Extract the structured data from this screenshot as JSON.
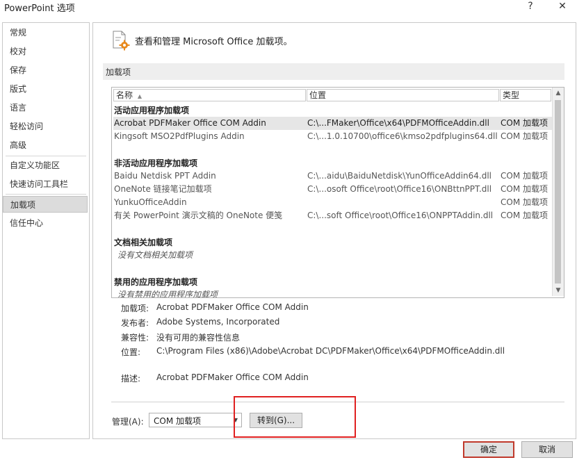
{
  "window": {
    "title": "PowerPoint 选项",
    "help_glyph": "?",
    "close_glyph": "✕"
  },
  "sidebar": {
    "items": [
      {
        "label": "常规"
      },
      {
        "label": "校对"
      },
      {
        "label": "保存"
      },
      {
        "label": "版式"
      },
      {
        "label": "语言"
      },
      {
        "label": "轻松访问"
      },
      {
        "label": "高级"
      },
      {
        "label": "自定义功能区"
      },
      {
        "label": "快速访问工具栏"
      },
      {
        "label": "加载项",
        "selected": true
      },
      {
        "label": "信任中心"
      }
    ]
  },
  "main": {
    "heading": "查看和管理 Microsoft Office 加载项。",
    "section_title": "加载项",
    "columns": {
      "name": "名称",
      "location": "位置",
      "type": "类型"
    },
    "groups": {
      "active": {
        "title": "活动应用程序加载项",
        "rows": [
          {
            "name": "Acrobat PDFMaker Office COM Addin",
            "location": "C:\\...FMaker\\Office\\x64\\PDFMOfficeAddin.dll",
            "type": "COM 加载项"
          },
          {
            "name": "Kingsoft MSO2PdfPlugins Addin",
            "location": "C:\\...1.0.10700\\office6\\kmso2pdfplugins64.dll",
            "type": "COM 加载项"
          }
        ]
      },
      "inactive": {
        "title": "非活动应用程序加载项",
        "rows": [
          {
            "name": "Baidu Netdisk PPT Addin",
            "location": "C:\\...aidu\\BaiduNetdisk\\YunOfficeAddin64.dll",
            "type": "COM 加载项"
          },
          {
            "name": "OneNote 链接笔记加载项",
            "location": "C:\\...osoft Office\\root\\Office16\\ONBttnPPT.dll",
            "type": "COM 加载项"
          },
          {
            "name": "YunkuOfficeAddin",
            "location": "",
            "type": "COM 加载项"
          },
          {
            "name": "有关 PowerPoint 演示文稿的 OneNote 便笺",
            "location": "C:\\...soft Office\\root\\Office16\\ONPPTAddin.dll",
            "type": "COM 加载项"
          }
        ]
      },
      "document": {
        "title": "文档相关加载项",
        "empty": "没有文档相关加载项"
      },
      "disabled": {
        "title": "禁用的应用程序加载项",
        "empty": "没有禁用的应用程序加载项"
      }
    },
    "details": {
      "addin_label": "加载项:",
      "addin_value": "Acrobat PDFMaker Office COM Addin",
      "publisher_label": "发布者:",
      "publisher_value": "Adobe Systems, Incorporated",
      "compat_label": "兼容性:",
      "compat_value": "没有可用的兼容性信息",
      "location_label": "位置:",
      "location_value": "C:\\Program Files (x86)\\Adobe\\Acrobat DC\\PDFMaker\\Office\\x64\\PDFMOfficeAddin.dll",
      "desc_label": "描述:",
      "desc_value": "Acrobat PDFMaker Office COM Addin"
    },
    "manage": {
      "label": "管理(A):",
      "selected": "COM 加载项",
      "go_button": "转到(G)..."
    }
  },
  "footer": {
    "ok": "确定",
    "cancel": "取消"
  },
  "colors": {
    "highlight_red": "#e02020",
    "selection_gray": "#dcdcdc"
  }
}
